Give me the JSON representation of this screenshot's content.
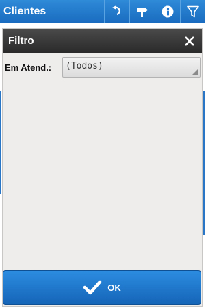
{
  "appbar": {
    "title": "Clientes",
    "icons": [
      "undo-icon",
      "signpost-icon",
      "info-icon",
      "filter-icon"
    ]
  },
  "dialog": {
    "title": "Filtro",
    "close_icon": "close-icon",
    "field_label": "Em Atend.:",
    "field_value": "(Todos)"
  },
  "ok_button": {
    "label": "OK",
    "icon": "checkmark-icon"
  },
  "colors": {
    "appbar": "#1f78cf",
    "dialog_header": "#333333",
    "dialog_body": "#efecec",
    "ok_button": "#1f78cf"
  }
}
